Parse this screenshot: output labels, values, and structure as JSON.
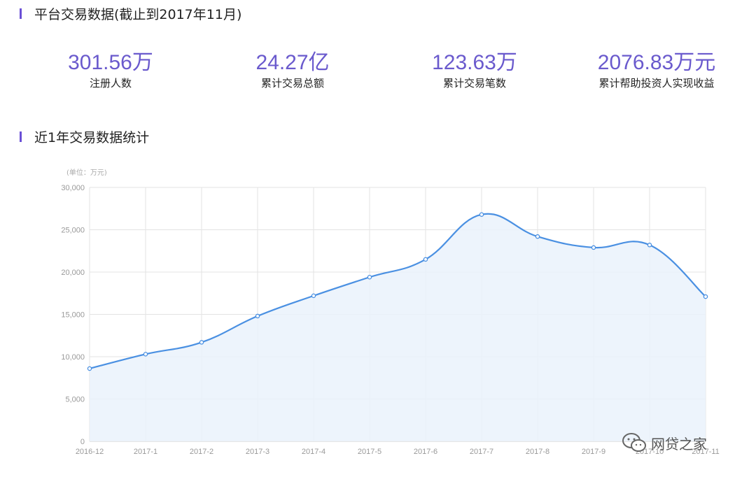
{
  "header": {
    "title": "平台交易数据(截止到2017年11月)"
  },
  "stats": [
    {
      "value": "301.56万",
      "label": "注册人数"
    },
    {
      "value": "24.27亿",
      "label": "累计交易总额"
    },
    {
      "value": "123.63万",
      "label": "累计交易笔数"
    },
    {
      "value": "2076.83万元",
      "label": "累计帮助投资人实现收益"
    }
  ],
  "section2": {
    "title": "近1年交易数据统计"
  },
  "colors": {
    "accent": "#6a4fd6",
    "stat_value": "#6a5acd",
    "line": "#4a90e2",
    "area": "#eaf2fc"
  },
  "watermark": {
    "text": "网贷之家",
    "icon": "wechat-icon"
  },
  "chart_data": {
    "type": "area",
    "unit_label": "(单位：万元)",
    "categories": [
      "2016-12",
      "2017-1",
      "2017-2",
      "2017-3",
      "2017-4",
      "2017-5",
      "2017-6",
      "2017-7",
      "2017-8",
      "2017-9",
      "2017-10",
      "2017-11"
    ],
    "values": [
      8600,
      10300,
      11700,
      14800,
      17200,
      19400,
      21500,
      26800,
      24200,
      22900,
      23200,
      17100
    ],
    "ylim": [
      0,
      30000
    ],
    "yticks": [
      "0",
      "5,000",
      "10,000",
      "15,000",
      "20,000",
      "25,000",
      "30,000"
    ],
    "grid": true,
    "legend": "none"
  }
}
